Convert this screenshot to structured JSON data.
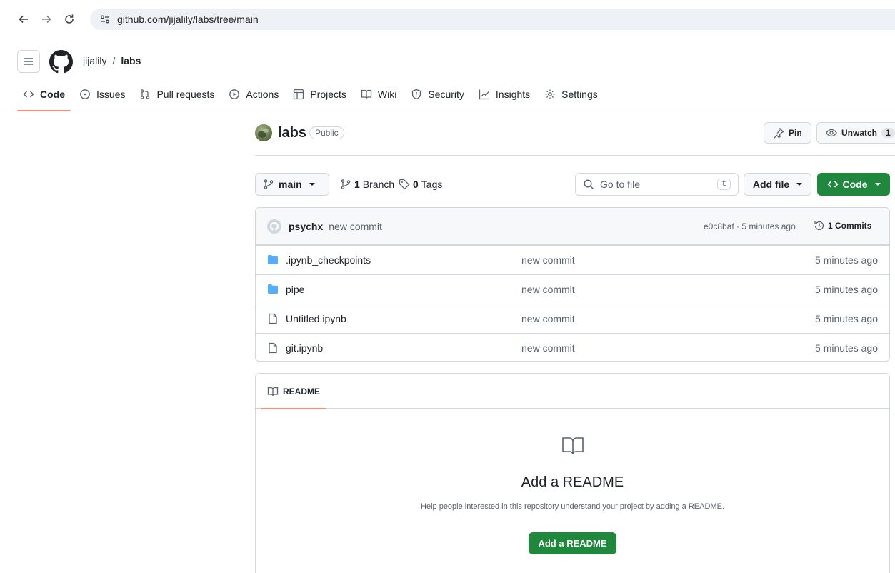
{
  "browser": {
    "url": "github.com/jijalily/labs/tree/main"
  },
  "header": {
    "owner": "jijalily",
    "separator": "/",
    "repo": "labs"
  },
  "tabs": [
    {
      "label": "Code",
      "icon": "code-icon",
      "active": true
    },
    {
      "label": "Issues",
      "icon": "issue-icon"
    },
    {
      "label": "Pull requests",
      "icon": "pull-request-icon"
    },
    {
      "label": "Actions",
      "icon": "play-icon"
    },
    {
      "label": "Projects",
      "icon": "table-icon"
    },
    {
      "label": "Wiki",
      "icon": "book-icon"
    },
    {
      "label": "Security",
      "icon": "shield-icon"
    },
    {
      "label": "Insights",
      "icon": "graph-icon"
    },
    {
      "label": "Settings",
      "icon": "gear-icon"
    }
  ],
  "repo_header": {
    "name": "labs",
    "visibility": "Public",
    "pin_label": "Pin",
    "watch_label": "Unwatch",
    "watch_count": "1"
  },
  "branch_bar": {
    "branch": "main",
    "branch_count": "1",
    "branch_label": "Branch",
    "tag_count": "0",
    "tag_label": "Tags",
    "goto_placeholder": "Go to file",
    "goto_shortcut": "t",
    "add_file_label": "Add file",
    "code_label": "Code"
  },
  "latest_commit": {
    "author": "psychx",
    "message": "new commit",
    "sha_time": "e0c8baf · 5 minutes ago",
    "commits_label": "1 Commits"
  },
  "files": [
    {
      "name": ".ipynb_checkpoints",
      "type": "folder",
      "message": "new commit",
      "date": "5 minutes ago"
    },
    {
      "name": "pipe",
      "type": "folder",
      "message": "new commit",
      "date": "5 minutes ago"
    },
    {
      "name": "Untitled.ipynb",
      "type": "file",
      "message": "new commit",
      "date": "5 minutes ago"
    },
    {
      "name": "git.ipynb",
      "type": "file",
      "message": "new commit",
      "date": "5 minutes ago"
    }
  ],
  "readme": {
    "tab_label": "README",
    "title": "Add a README",
    "description": "Help people interested in this repository understand your project by adding a README.",
    "button_label": "Add a README"
  },
  "colors": {
    "accent_green": "#1f883d",
    "tab_underline": "#fd8c73",
    "folder_blue": "#54aeff",
    "border": "#d0d7de"
  }
}
